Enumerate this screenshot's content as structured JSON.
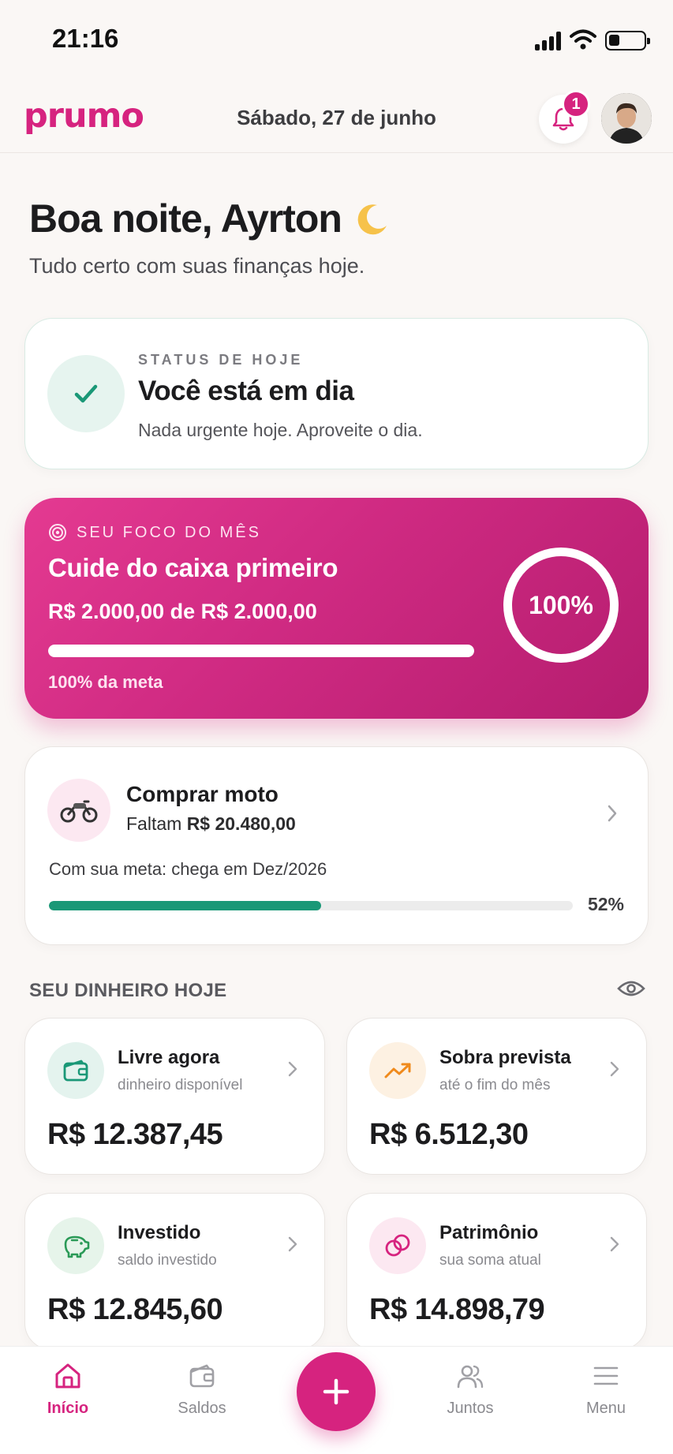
{
  "status_bar": {
    "time": "21:16"
  },
  "header": {
    "logo": "prumo",
    "date": "Sábado, 27 de junho",
    "notification_count": "1"
  },
  "greeting": {
    "title": "Boa noite, Ayrton",
    "subtitle": "Tudo certo com suas finanças hoje."
  },
  "status_card": {
    "label": "STATUS DE HOJE",
    "title": "Você está em dia",
    "subtitle": "Nada urgente hoje. Aproveite o dia."
  },
  "focus_card": {
    "label": "SEU FOCO DO MÊS",
    "title": "Cuide do caixa primeiro",
    "amount": "R$ 2.000,00 de R$ 2.000,00",
    "meta_text": "100% da meta",
    "ring_text": "100%",
    "progress": 1.0
  },
  "goal_card": {
    "title": "Comprar moto",
    "remaining_prefix": "Faltam",
    "remaining_value": "R$ 20.480,00",
    "eta": "Com sua meta: chega em Dez/2026",
    "percent_text": "52%",
    "progress": 0.52
  },
  "money": {
    "heading": "SEU DINHEIRO HOJE",
    "cards": [
      {
        "title": "Livre agora",
        "subtitle": "dinheiro disponível",
        "value": "R$ 12.387,45",
        "icon": "wallet-icon",
        "color": "#1a9877",
        "bg": "#e4f3ee"
      },
      {
        "title": "Sobra prevista",
        "subtitle": "até o fim do mês",
        "value": "R$ 6.512,30",
        "icon": "trend-up-icon",
        "color": "#f08a1c",
        "bg": "#fdf1e2"
      },
      {
        "title": "Investido",
        "subtitle": "saldo investido",
        "value": "R$ 12.845,60",
        "icon": "piggy-bank-icon",
        "color": "#2a9a57",
        "bg": "#e6f4ea"
      },
      {
        "title": "Patrimônio",
        "subtitle": "sua soma atual",
        "value": "R$ 14.898,79",
        "icon": "coins-icon",
        "color": "#d6237f",
        "bg": "#fce8f1"
      }
    ]
  },
  "nav": {
    "home": "Início",
    "balances": "Saldos",
    "together": "Juntos",
    "menu": "Menu"
  },
  "colors": {
    "accent": "#d6237f",
    "success": "#1a9877"
  }
}
